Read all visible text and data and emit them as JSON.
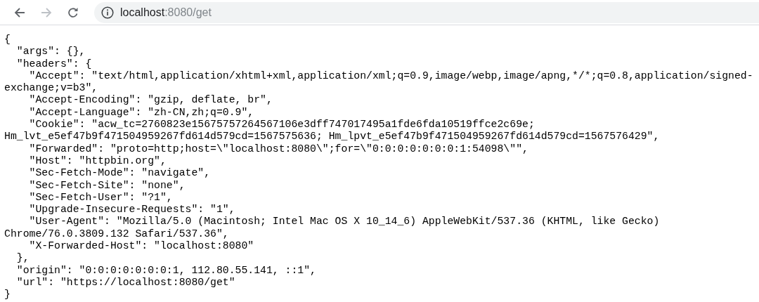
{
  "toolbar": {
    "back": {
      "disabled": false
    },
    "forward": {
      "disabled": true
    },
    "address": {
      "host": "localhost",
      "path": ":8080/get"
    }
  },
  "body_lines": [
    "{",
    "  \"args\": {},",
    "  \"headers\": {",
    "    \"Accept\": \"text/html,application/xhtml+xml,application/xml;q=0.9,image/webp,image/apng,*/*;q=0.8,application/signed-",
    "exchange;v=b3\",",
    "    \"Accept-Encoding\": \"gzip, deflate, br\",",
    "    \"Accept-Language\": \"zh-CN,zh;q=0.9\",",
    "    \"Cookie\": \"acw_tc=2760823e15675757264567106e3dff747017495a1fde6fda10519ffce2c69e;",
    "Hm_lvt_e5ef47b9f471504959267fd614d579cd=1567575636; Hm_lpvt_e5ef47b9f471504959267fd614d579cd=1567576429\",",
    "    \"Forwarded\": \"proto=http;host=\\\"localhost:8080\\\";for=\\\"0:0:0:0:0:0:0:1:54098\\\"\",",
    "    \"Host\": \"httpbin.org\",",
    "    \"Sec-Fetch-Mode\": \"navigate\",",
    "    \"Sec-Fetch-Site\": \"none\",",
    "    \"Sec-Fetch-User\": \"?1\",",
    "    \"Upgrade-Insecure-Requests\": \"1\",",
    "    \"User-Agent\": \"Mozilla/5.0 (Macintosh; Intel Mac OS X 10_14_6) AppleWebKit/537.36 (KHTML, like Gecko)",
    "Chrome/76.0.3809.132 Safari/537.36\",",
    "    \"X-Forwarded-Host\": \"localhost:8080\"",
    "  },",
    "  \"origin\": \"0:0:0:0:0:0:0:1, 112.80.55.141, ::1\",",
    "  \"url\": \"https://localhost:8080/get\"",
    "}"
  ]
}
